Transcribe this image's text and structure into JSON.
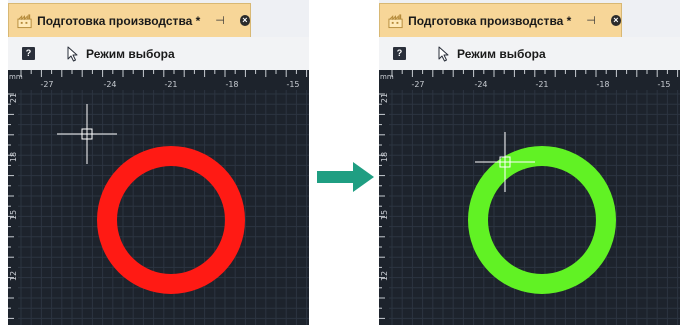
{
  "panels": [
    {
      "state": "before",
      "tab": {
        "title": "Подготовка производства *",
        "pin_icon": "pin-icon",
        "close_icon": "close-icon"
      },
      "toolbar": {
        "help_label": "?",
        "mode_label": "Режим выбора"
      },
      "ruler": {
        "unit": "mm",
        "x_ticks": [
          "-27",
          "-24",
          "-21",
          "-18",
          "-15"
        ],
        "y_ticks": [
          "21",
          "18",
          "15",
          "12"
        ]
      },
      "ring": {
        "color": "#ff1a14"
      }
    },
    {
      "state": "after",
      "tab": {
        "title": "Подготовка производства *",
        "pin_icon": "pin-icon",
        "close_icon": "close-icon"
      },
      "toolbar": {
        "help_label": "?",
        "mode_label": "Режим выбора"
      },
      "ruler": {
        "unit": "mm",
        "x_ticks": [
          "-27",
          "-24",
          "-21",
          "-18",
          "-15"
        ],
        "y_ticks": [
          "21",
          "18",
          "15",
          "12"
        ]
      },
      "ring": {
        "color": "#61f224"
      }
    }
  ],
  "transition_arrow": {
    "color": "#1f9e82"
  }
}
